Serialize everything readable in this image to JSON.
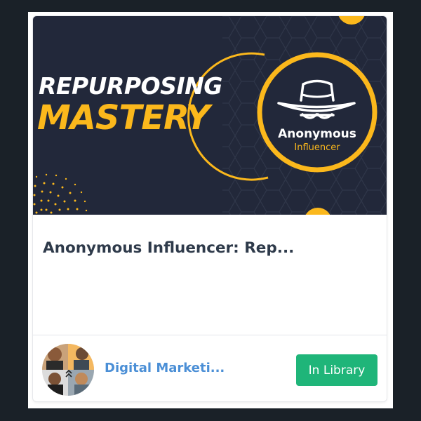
{
  "banner": {
    "headline_line1": "REPURPOSING",
    "headline_line2": "MASTERY",
    "logo_name": "Anonymous",
    "logo_sub": "Influencer"
  },
  "product": {
    "title": "Anonymous Influencer: Rep..."
  },
  "seller": {
    "name": "Digital Marketi..."
  },
  "action": {
    "label": "In Library"
  },
  "colors": {
    "page_background": "#1a2128",
    "banner_background": "#22283a",
    "accent_yellow": "#fbb81c",
    "button_green": "#1fb579",
    "seller_link": "#4b8fd6",
    "title_text": "#2e3a4a"
  },
  "icons": {
    "logo": "spy-hat-glasses-icon",
    "avatar": "seller-avatar-collage"
  }
}
